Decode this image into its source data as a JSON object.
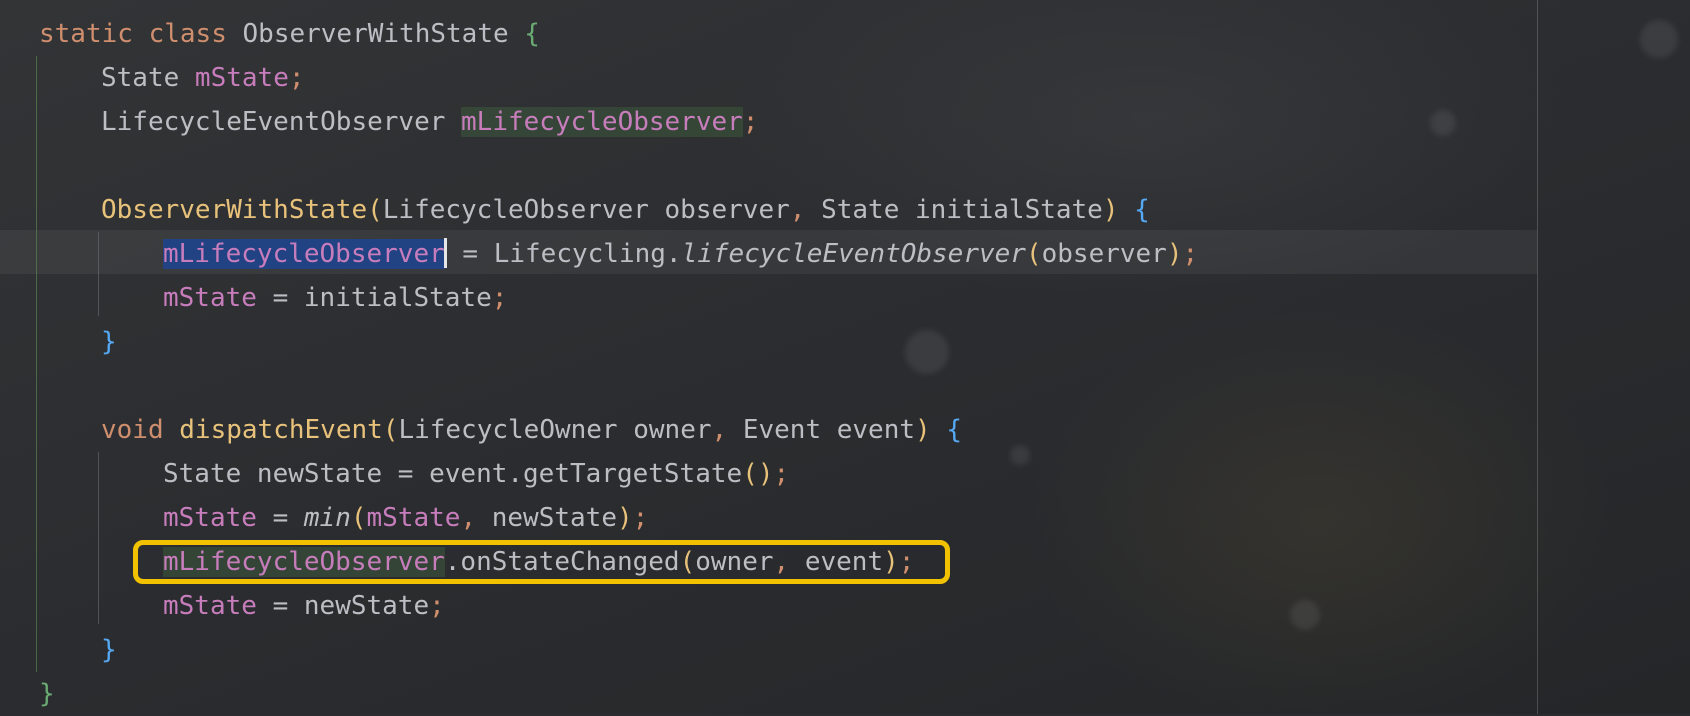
{
  "editor": {
    "lines": [
      {
        "indent": 1,
        "tokens": [
          {
            "text": "static",
            "cls": "kw"
          },
          {
            "text": " "
          },
          {
            "text": "class",
            "cls": "kw"
          },
          {
            "text": " ObserverWithState "
          },
          {
            "text": "{",
            "cls": "brg"
          }
        ]
      },
      {
        "indent": 2,
        "tokens": [
          {
            "text": "State "
          },
          {
            "text": "mState",
            "cls": "fld"
          },
          {
            "text": ";",
            "cls": "pn"
          }
        ]
      },
      {
        "indent": 2,
        "tokens": [
          {
            "text": "LifecycleEventObserver "
          },
          {
            "text": "mLifecycleObserver",
            "cls": "fld usage"
          },
          {
            "text": ";",
            "cls": "pn"
          }
        ]
      },
      {
        "indent": 0,
        "tokens": []
      },
      {
        "indent": 2,
        "tokens": [
          {
            "text": "ObserverWithState",
            "cls": "fn"
          },
          {
            "text": "(",
            "cls": "br1"
          },
          {
            "text": "LifecycleObserver observer"
          },
          {
            "text": ",",
            "cls": "pn"
          },
          {
            "text": " State initialState"
          },
          {
            "text": ")",
            "cls": "br1"
          },
          {
            "text": " "
          },
          {
            "text": "{",
            "cls": "br2"
          }
        ]
      },
      {
        "indent": 3,
        "tokens": [
          {
            "text": "mLifecycleObserver",
            "cls": "fld sel"
          },
          {
            "caret": true
          },
          {
            "text": " = Lifecycling."
          },
          {
            "text": "lifecycleEventObserver",
            "cls": "it"
          },
          {
            "text": "(",
            "cls": "br1"
          },
          {
            "text": "observer"
          },
          {
            "text": ")",
            "cls": "br1"
          },
          {
            "text": ";",
            "cls": "pn"
          }
        ]
      },
      {
        "indent": 3,
        "tokens": [
          {
            "text": "mState",
            "cls": "fld"
          },
          {
            "text": " = initialState"
          },
          {
            "text": ";",
            "cls": "pn"
          }
        ]
      },
      {
        "indent": 2,
        "tokens": [
          {
            "text": "}",
            "cls": "br2"
          }
        ]
      },
      {
        "indent": 0,
        "tokens": []
      },
      {
        "indent": 2,
        "tokens": [
          {
            "text": "void",
            "cls": "kw"
          },
          {
            "text": " "
          },
          {
            "text": "dispatchEvent",
            "cls": "fn"
          },
          {
            "text": "(",
            "cls": "br1"
          },
          {
            "text": "LifecycleOwner owner"
          },
          {
            "text": ",",
            "cls": "pn"
          },
          {
            "text": " Event event"
          },
          {
            "text": ")",
            "cls": "br1"
          },
          {
            "text": " "
          },
          {
            "text": "{",
            "cls": "br2"
          }
        ]
      },
      {
        "indent": 3,
        "tokens": [
          {
            "text": "State newState = event.getTargetState"
          },
          {
            "text": "()",
            "cls": "br1"
          },
          {
            "text": ";",
            "cls": "pn"
          }
        ]
      },
      {
        "indent": 3,
        "tokens": [
          {
            "text": "mState",
            "cls": "fld"
          },
          {
            "text": " = "
          },
          {
            "text": "min",
            "cls": "it"
          },
          {
            "text": "(",
            "cls": "br1"
          },
          {
            "text": "mState",
            "cls": "fld"
          },
          {
            "text": ",",
            "cls": "pn"
          },
          {
            "text": " newState"
          },
          {
            "text": ")",
            "cls": "br1"
          },
          {
            "text": ";",
            "cls": "pn"
          }
        ]
      },
      {
        "indent": 3,
        "tokens": [
          {
            "text": "mLifecycleObserver",
            "cls": "fld usage"
          },
          {
            "text": ".onStateChanged"
          },
          {
            "text": "(",
            "cls": "br1"
          },
          {
            "text": "owner"
          },
          {
            "text": ",",
            "cls": "pn"
          },
          {
            "text": " event"
          },
          {
            "text": ")",
            "cls": "br1"
          },
          {
            "text": ";",
            "cls": "pn"
          }
        ]
      },
      {
        "indent": 3,
        "tokens": [
          {
            "text": "mState",
            "cls": "fld"
          },
          {
            "text": " = newState"
          },
          {
            "text": ";",
            "cls": "pn"
          }
        ]
      },
      {
        "indent": 2,
        "tokens": [
          {
            "text": "}",
            "cls": "br2"
          }
        ]
      },
      {
        "indent": 1,
        "tokens": [
          {
            "text": "}",
            "cls": "brg"
          }
        ]
      }
    ]
  },
  "colors": {
    "keyword": "#cf8e6d",
    "function": "#e8c27a",
    "field": "#c77dbb",
    "text": "#bcbec4",
    "brace_blue": "#55a8f2",
    "brace_green": "#6aab73",
    "selection": "#214283",
    "highlight_box": "#f2c200"
  }
}
